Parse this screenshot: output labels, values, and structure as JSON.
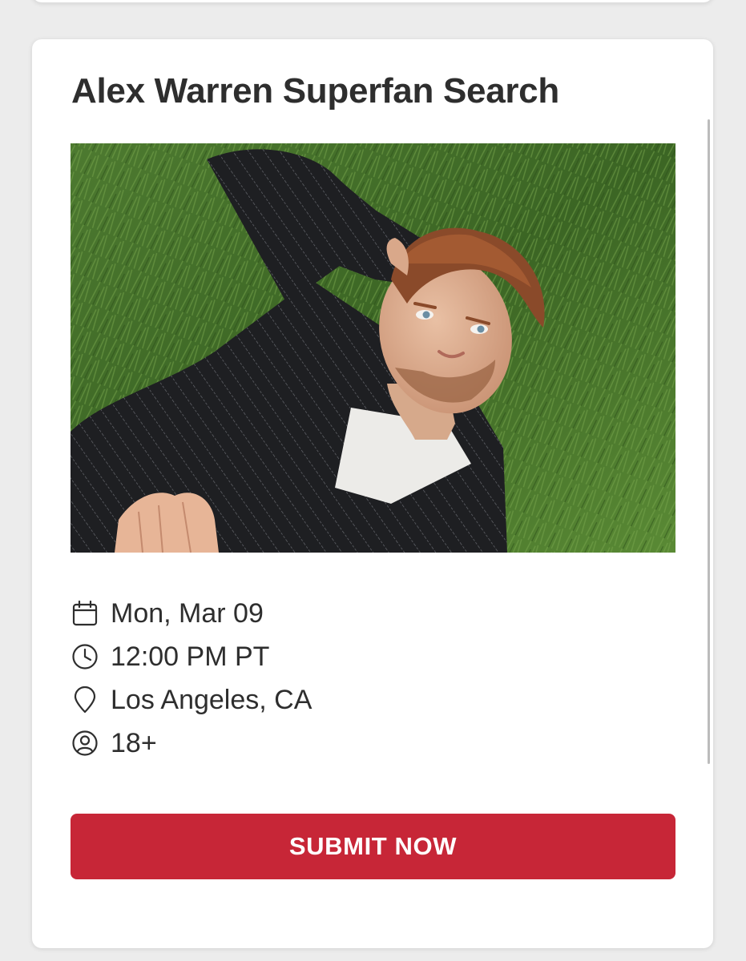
{
  "event": {
    "title": "Alex Warren Superfan Search",
    "image_alt": "Alex Warren lying on grass"
  },
  "details": [
    {
      "icon": "calendar-icon",
      "text": "Mon, Mar 09"
    },
    {
      "icon": "clock-icon",
      "text": "12:00 PM PT"
    },
    {
      "icon": "location-pin-icon",
      "text": "Los Angeles, CA"
    },
    {
      "icon": "user-circle-icon",
      "text": "18+"
    }
  ],
  "actions": {
    "submit_label": "SUBMIT NOW"
  },
  "colors": {
    "accent": "#c72637",
    "title_text": "#2e2e2e",
    "page_background": "#ececec",
    "card_background": "#ffffff"
  }
}
